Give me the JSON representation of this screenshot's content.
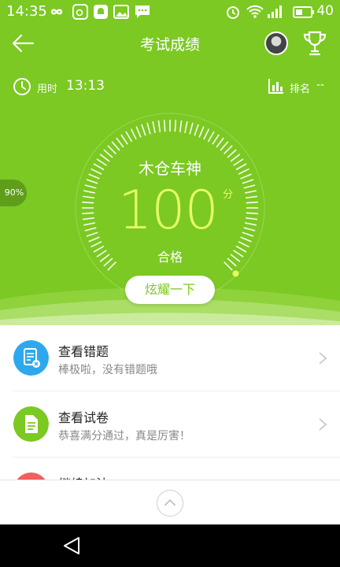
{
  "status_bar": {
    "time": "14:35",
    "battery": "40",
    "icons": [
      "infinity-icon",
      "weibo-icon",
      "app-icon",
      "image-icon",
      "message-icon",
      "alarm-icon",
      "wifi-icon",
      "signal-icon",
      "battery-icon"
    ]
  },
  "header": {
    "title": "考试成绩",
    "back_icon": "arrow-left-icon",
    "trophy_icon": "trophy-icon"
  },
  "info": {
    "used_label": "用时",
    "used_value": "13:13",
    "rank_label": "排名",
    "rank_value": "--"
  },
  "gauge": {
    "percent_badge": "90%",
    "user_name": "木仓车神",
    "score": "100",
    "score_unit": "分",
    "result": "合格",
    "share_label": "炫耀一下",
    "progress_fraction": 1.0
  },
  "list": {
    "items": [
      {
        "title": "查看错题",
        "subtitle": "棒极啦，没有错题哦",
        "icon": "wrong-questions-icon",
        "color": "#2ea8ec"
      },
      {
        "title": "查看试卷",
        "subtitle": "恭喜满分通过，真是厉害！",
        "icon": "document-icon",
        "color": "#7bc922"
      },
      {
        "title": "继续加油",
        "subtitle": "",
        "icon": "cheer-icon",
        "color": "#f06060"
      }
    ]
  },
  "colors": {
    "primary_green": "#7bc922",
    "score_yellow": "#e6ff66"
  }
}
